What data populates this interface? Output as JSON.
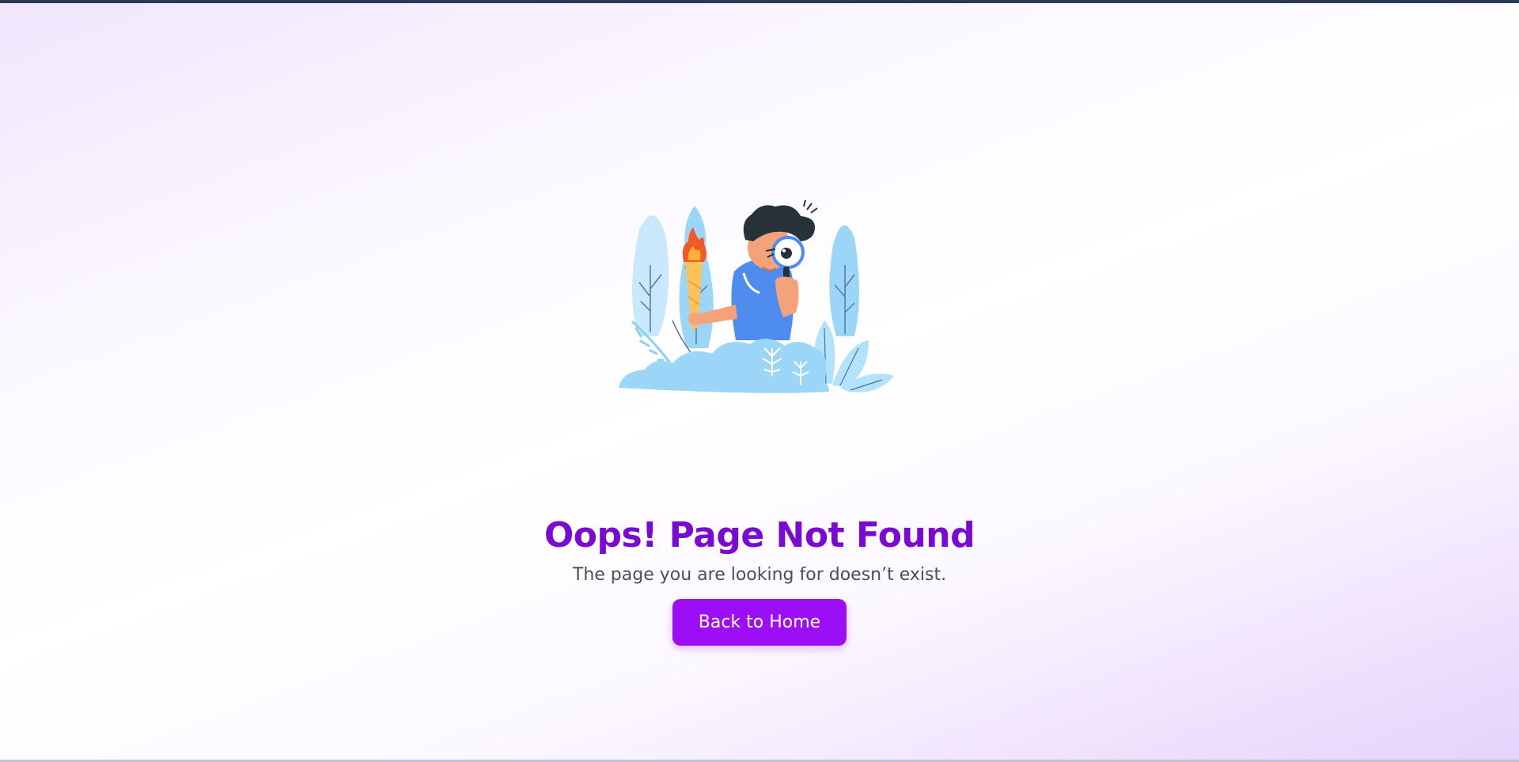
{
  "theme": {
    "accent": "#9c0ff6",
    "title_color": "#7a0ad3",
    "text_color": "#4b4f58"
  },
  "error": {
    "illustration_icon": "person-with-magnifier-and-torch-illustration",
    "title": "Oops! Page Not Found",
    "message": "The page you are looking for doesn’t exist.",
    "button_label": "Back to Home"
  }
}
